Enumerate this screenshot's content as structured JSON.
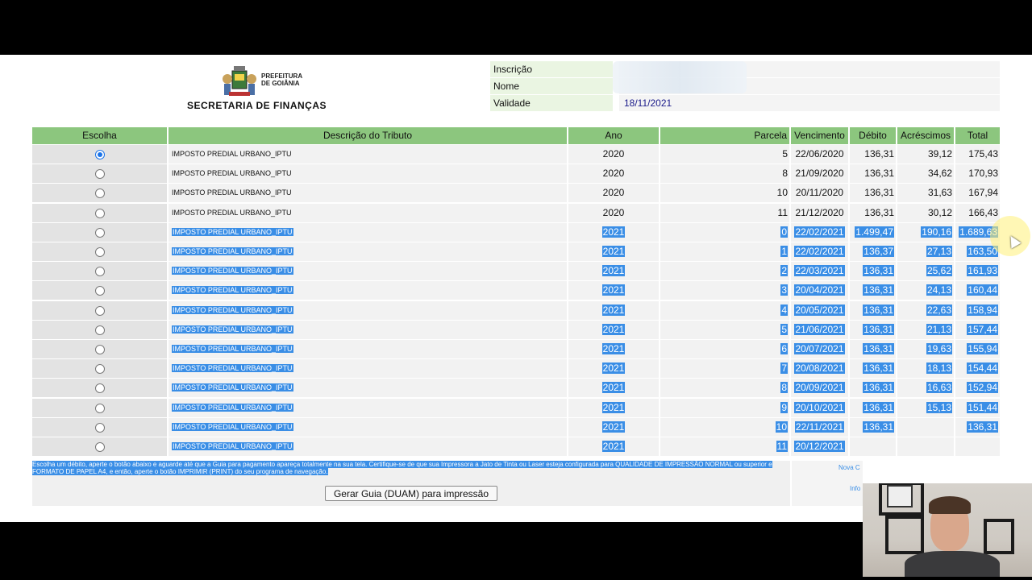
{
  "header": {
    "pref_line1": "PREFEITURA",
    "pref_line2": "DE GOIÂNIA",
    "secretaria": "SECRETARIA DE FINANÇAS",
    "info": [
      {
        "label": "Inscrição",
        "value": ""
      },
      {
        "label": "Nome",
        "value": ""
      },
      {
        "label": "Validade",
        "value": "18/11/2021"
      }
    ]
  },
  "table": {
    "columns": [
      "Escolha",
      "Descrição do Tributo",
      "Ano",
      "Parcela",
      "Vencimento",
      "Débito",
      "Acréscimos",
      "Total"
    ],
    "rows": [
      {
        "selected": true,
        "highlight": false,
        "desc": "IMPOSTO PREDIAL URBANO_IPTU",
        "ano": "2020",
        "parcela": "5",
        "venc": "22/06/2020",
        "debito": "136,31",
        "acresc": "39,12",
        "total": "175,43"
      },
      {
        "selected": false,
        "highlight": false,
        "desc": "IMPOSTO PREDIAL URBANO_IPTU",
        "ano": "2020",
        "parcela": "8",
        "venc": "21/09/2020",
        "debito": "136,31",
        "acresc": "34,62",
        "total": "170,93"
      },
      {
        "selected": false,
        "highlight": false,
        "desc": "IMPOSTO PREDIAL URBANO_IPTU",
        "ano": "2020",
        "parcela": "10",
        "venc": "20/11/2020",
        "debito": "136,31",
        "acresc": "31,63",
        "total": "167,94"
      },
      {
        "selected": false,
        "highlight": false,
        "desc": "IMPOSTO PREDIAL URBANO_IPTU",
        "ano": "2020",
        "parcela": "11",
        "venc": "21/12/2020",
        "debito": "136,31",
        "acresc": "30,12",
        "total": "166,43"
      },
      {
        "selected": false,
        "highlight": true,
        "desc": "IMPOSTO PREDIAL URBANO_IPTU",
        "ano": "2021",
        "parcela": "0",
        "venc": "22/02/2021",
        "debito": "1.499,47",
        "acresc": "190,16",
        "total": "1.689,63"
      },
      {
        "selected": false,
        "highlight": true,
        "desc": "IMPOSTO PREDIAL URBANO_IPTU",
        "ano": "2021",
        "parcela": "1",
        "venc": "22/02/2021",
        "debito": "136,37",
        "acresc": "27,13",
        "total": "163,50"
      },
      {
        "selected": false,
        "highlight": true,
        "desc": "IMPOSTO PREDIAL URBANO_IPTU",
        "ano": "2021",
        "parcela": "2",
        "venc": "22/03/2021",
        "debito": "136,31",
        "acresc": "25,62",
        "total": "161,93"
      },
      {
        "selected": false,
        "highlight": true,
        "desc": "IMPOSTO PREDIAL URBANO_IPTU",
        "ano": "2021",
        "parcela": "3",
        "venc": "20/04/2021",
        "debito": "136,31",
        "acresc": "24,13",
        "total": "160,44"
      },
      {
        "selected": false,
        "highlight": true,
        "desc": "IMPOSTO PREDIAL URBANO_IPTU",
        "ano": "2021",
        "parcela": "4",
        "venc": "20/05/2021",
        "debito": "136,31",
        "acresc": "22,63",
        "total": "158,94"
      },
      {
        "selected": false,
        "highlight": true,
        "desc": "IMPOSTO PREDIAL URBANO_IPTU",
        "ano": "2021",
        "parcela": "5",
        "venc": "21/06/2021",
        "debito": "136,31",
        "acresc": "21,13",
        "total": "157,44"
      },
      {
        "selected": false,
        "highlight": true,
        "desc": "IMPOSTO PREDIAL URBANO_IPTU",
        "ano": "2021",
        "parcela": "6",
        "venc": "20/07/2021",
        "debito": "136,31",
        "acresc": "19,63",
        "total": "155,94"
      },
      {
        "selected": false,
        "highlight": true,
        "desc": "IMPOSTO PREDIAL URBANO_IPTU",
        "ano": "2021",
        "parcela": "7",
        "venc": "20/08/2021",
        "debito": "136,31",
        "acresc": "18,13",
        "total": "154,44"
      },
      {
        "selected": false,
        "highlight": true,
        "desc": "IMPOSTO PREDIAL URBANO_IPTU",
        "ano": "2021",
        "parcela": "8",
        "venc": "20/09/2021",
        "debito": "136,31",
        "acresc": "16,63",
        "total": "152,94"
      },
      {
        "selected": false,
        "highlight": true,
        "desc": "IMPOSTO PREDIAL URBANO_IPTU",
        "ano": "2021",
        "parcela": "9",
        "venc": "20/10/2021",
        "debito": "136,31",
        "acresc": "15,13",
        "total": "151,44"
      },
      {
        "selected": false,
        "highlight": true,
        "desc": "IMPOSTO PREDIAL URBANO_IPTU",
        "ano": "2021",
        "parcela": "10",
        "venc": "22/11/2021",
        "debito": "136,31",
        "acresc": "",
        "total": "136,31"
      },
      {
        "selected": false,
        "highlight": true,
        "desc": "IMPOSTO PREDIAL URBANO_IPTU",
        "ano": "2021",
        "parcela": "11",
        "venc": "20/12/2021",
        "debito": "",
        "acresc": "",
        "total": ""
      }
    ]
  },
  "footer": {
    "instructions": "Escolha um débito, aperte o botão abaixo e aguarde até que a Guia para pagamento apareça totalmente na sua tela. Certifique-se de que sua Impressora a Jato de Tinta ou Laser esteja configurada para QUALIDADE DE IMPRESSÃO NORMAL ou superior e FORMATO DE PAPEL A4, e então, aperte o botão IMPRIMIR (PRINT) do seu programa de navegação.",
    "generate_button": "Gerar Guia (DUAM) para impressão",
    "nova_link": "Nova C",
    "info_link": "Info"
  },
  "colors": {
    "header_green": "#8cc67e",
    "selection_blue": "#3a8ee6",
    "info_label_bg": "#eaf5e2"
  }
}
